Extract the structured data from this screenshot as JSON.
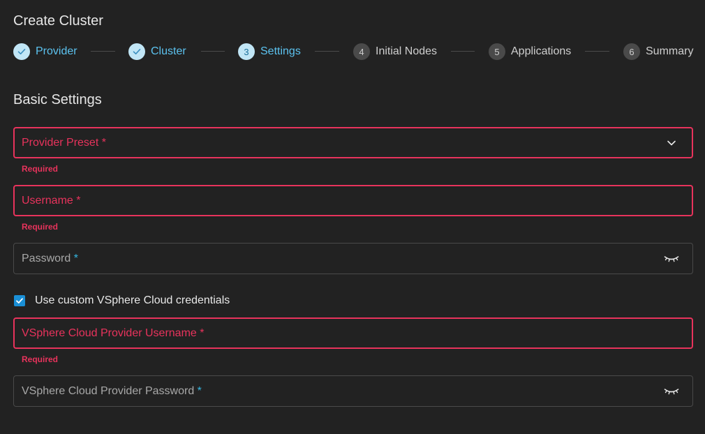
{
  "page": {
    "title": "Create Cluster"
  },
  "stepper": {
    "steps": [
      {
        "number": "",
        "label": "Provider",
        "state": "done"
      },
      {
        "number": "",
        "label": "Cluster",
        "state": "done"
      },
      {
        "number": "3",
        "label": "Settings",
        "state": "active"
      },
      {
        "number": "4",
        "label": "Initial Nodes",
        "state": "pending"
      },
      {
        "number": "5",
        "label": "Applications",
        "state": "pending"
      },
      {
        "number": "6",
        "label": "Summary",
        "state": "pending"
      }
    ]
  },
  "section": {
    "title": "Basic Settings"
  },
  "form": {
    "provider_preset": {
      "label": "Provider Preset",
      "asterisk": " *",
      "error": "Required"
    },
    "username": {
      "label": "Username",
      "asterisk": " *",
      "error": "Required"
    },
    "password": {
      "label": "Password",
      "asterisk": " *"
    },
    "custom_credentials": {
      "label": "Use custom VSphere Cloud credentials",
      "checked": true
    },
    "vsphere_username": {
      "label": "VSphere Cloud Provider Username",
      "asterisk": " *",
      "error": "Required"
    },
    "vsphere_password": {
      "label": "VSphere Cloud Provider Password",
      "asterisk": " *"
    }
  },
  "icons": {
    "step_done": "check-icon",
    "dropdown": "chevron-down-icon",
    "password_toggle": "eye-closed-icon",
    "checkbox": "checkmark-icon"
  },
  "colors": {
    "background": "#222222",
    "accent_blue": "#5cc3f0",
    "step_done_bg": "#c1e6f6",
    "error": "#e8335c",
    "checkbox": "#1a8fd6"
  }
}
